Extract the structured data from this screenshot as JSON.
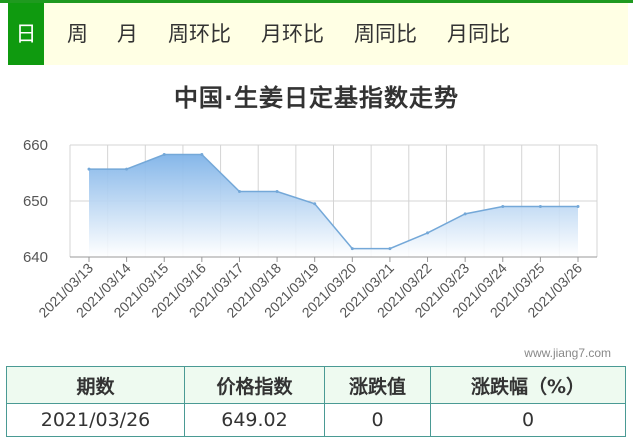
{
  "tabs": [
    {
      "label": "日",
      "active": true
    },
    {
      "label": "周",
      "active": false
    },
    {
      "label": "月",
      "active": false
    },
    {
      "label": "周环比",
      "active": false
    },
    {
      "label": "月环比",
      "active": false
    },
    {
      "label": "周同比",
      "active": false
    },
    {
      "label": "月同比",
      "active": false
    }
  ],
  "watermark": "www.jiang7.com",
  "chart_data": {
    "type": "area",
    "title": "中国·生姜日定基指数走势",
    "xlabel": "",
    "ylabel": "",
    "categories": [
      "2021/03/13",
      "2021/03/14",
      "2021/03/15",
      "2021/03/16",
      "2021/03/17",
      "2021/03/18",
      "2021/03/19",
      "2021/03/20",
      "2021/03/21",
      "2021/03/22",
      "2021/03/23",
      "2021/03/24",
      "2021/03/25",
      "2021/03/26"
    ],
    "values": [
      655.7,
      655.7,
      658.3,
      658.3,
      651.7,
      651.7,
      649.5,
      641.5,
      641.5,
      644.3,
      647.7,
      649.02,
      649.02,
      649.02
    ],
    "ylim": [
      640,
      660
    ],
    "yticks": [
      640,
      650,
      660
    ],
    "grid": true,
    "colors": {
      "line": "#74a8d8",
      "fill_top": "#7fb3e8",
      "fill_bottom": "#ffffff",
      "grid": "#d4d4d4"
    }
  },
  "table": {
    "headers": [
      "期数",
      "价格指数",
      "涨跌值",
      "涨跌幅（%）"
    ],
    "rows": [
      [
        "2021/03/26",
        "649.02",
        "0",
        "0"
      ]
    ]
  }
}
